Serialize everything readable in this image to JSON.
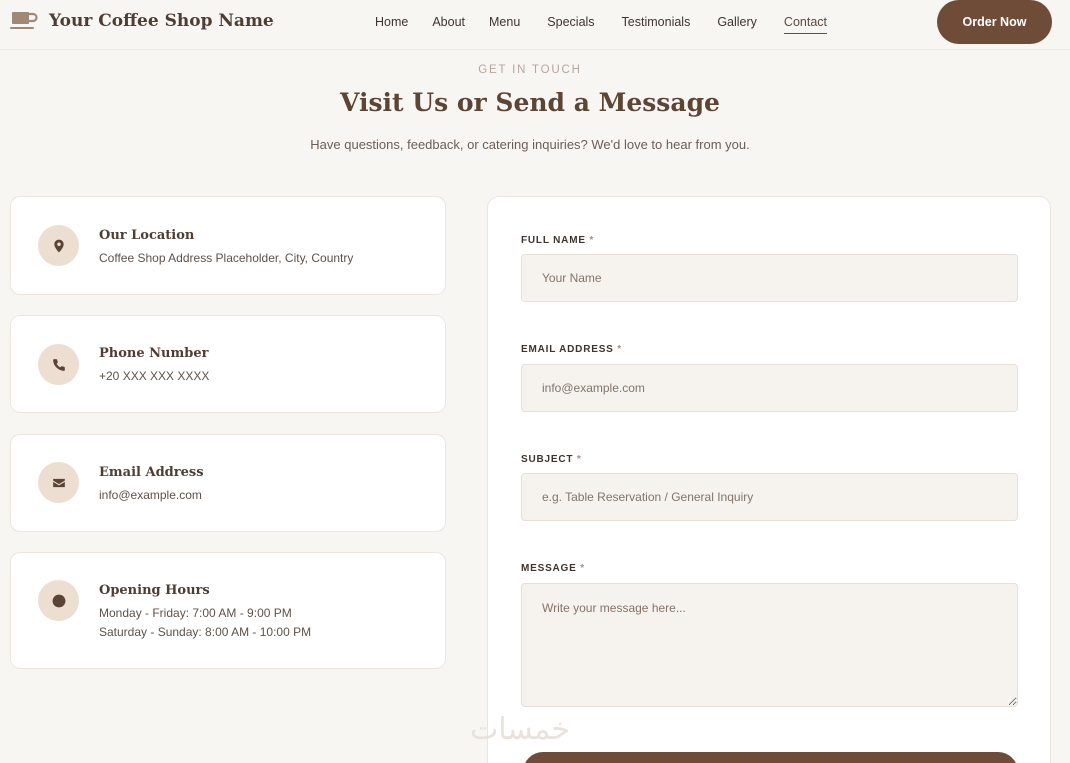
{
  "header": {
    "brand": "Your Coffee Shop Name",
    "nav": [
      {
        "label": "Home",
        "active": false
      },
      {
        "label": "About",
        "active": false
      },
      {
        "label": "Menu",
        "active": false
      },
      {
        "label": "Specials",
        "active": false
      },
      {
        "label": "Testimonials",
        "active": false
      },
      {
        "label": "Gallery",
        "active": false
      },
      {
        "label": "Contact",
        "active": true
      }
    ],
    "order_label": "Order Now"
  },
  "intro": {
    "eyebrow": "GET IN TOUCH",
    "title": "Visit Us or Send a Message",
    "subtitle": "Have questions, feedback, or catering inquiries? We'd love to hear from you."
  },
  "info_cards": [
    {
      "icon": "location-pin-icon",
      "title": "Our Location",
      "lines": [
        "Coffee Shop Address Placeholder, City, Country"
      ]
    },
    {
      "icon": "phone-icon",
      "title": "Phone Number",
      "lines": [
        "+20 XXX XXX XXXX"
      ]
    },
    {
      "icon": "envelope-icon",
      "title": "Email Address",
      "lines": [
        "info@example.com"
      ]
    },
    {
      "icon": "clock-icon",
      "title": "Opening Hours",
      "lines": [
        "Monday - Friday: 7:00 AM - 9:00 PM",
        "Saturday - Sunday: 8:00 AM - 10:00 PM"
      ]
    }
  ],
  "form": {
    "name_label": "FULL NAME",
    "name_placeholder": "Your Name",
    "email_label": "EMAIL ADDRESS",
    "email_placeholder": "info@example.com",
    "subject_label": "SUBJECT",
    "subject_placeholder": "e.g. Table Reservation / General Inquiry",
    "message_label": "MESSAGE",
    "message_placeholder": "Write your message here...",
    "required_mark": "*"
  },
  "watermark": "خمسات",
  "colors": {
    "accent": "#6e4c38",
    "background": "#f8f6f3",
    "icon_circle": "#ecdfd1",
    "input_bg": "#f6f2ed"
  }
}
